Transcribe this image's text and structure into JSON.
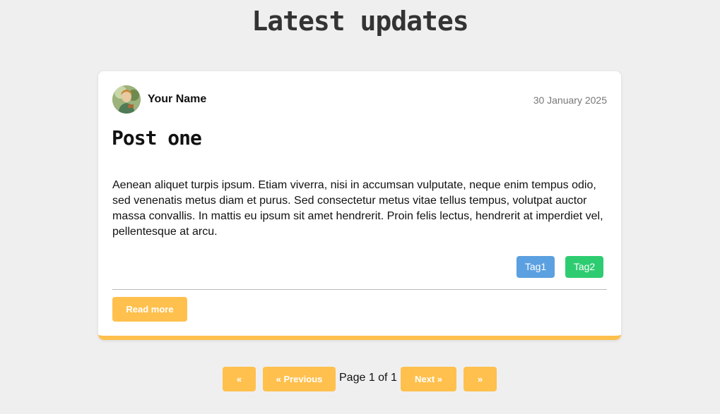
{
  "header": {
    "title": "Latest updates"
  },
  "post": {
    "author": "Your Name",
    "date": "30 January 2025",
    "title": "Post one",
    "body": "Aenean aliquet turpis ipsum. Etiam viverra, nisi in accumsan vulputate, neque enim tempus odio, sed venenatis metus diam et purus. Sed consectetur metus vitae tellus tempus, volutpat auctor massa convallis. In mattis eu ipsum sit amet hendrerit. Proin felis lectus, hendrerit at imperdiet vel, pellentesque at arcu.",
    "tags": [
      "Tag1",
      "Tag2"
    ],
    "read_more_label": "Read more",
    "avatar_icon": "user-avatar-icon"
  },
  "pagination": {
    "first_label": "«",
    "previous_label": "« Previous",
    "page_info": "Page 1 of 1",
    "next_label": "Next »",
    "last_label": "»"
  },
  "colors": {
    "accent": "#ffc04d",
    "tag1": "#5ba0e0",
    "tag2": "#2ecc71",
    "background": "#efefef"
  }
}
